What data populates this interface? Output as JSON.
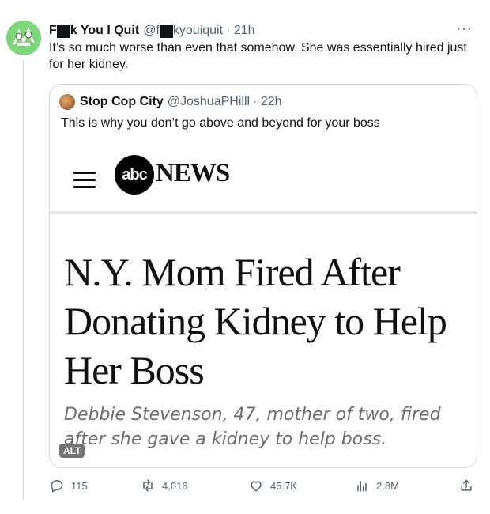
{
  "tweet": {
    "display_name_prefix": "F",
    "display_name_suffix": "k You I Quit",
    "handle_prefix": "@f",
    "handle_suffix": "kyouiquit",
    "time": "· 21h",
    "text": "It’s so much worse than even that somehow. She was essentially hired just for her kidney.",
    "more_label": "···"
  },
  "quote": {
    "display_name": "Stop Cop City",
    "handle": "@JoshuaPHilll",
    "time": "· 22h",
    "text": "This is why you don’t go above and beyond for your boss",
    "media": {
      "logo_text": "abc",
      "brand_text": "NEWS",
      "headline": "N.Y. Mom Fired After Donating Kidney to Help Her Boss",
      "subhead": "Debbie Stevenson, 47, mother of two, fired after she gave a kidney to help boss.",
      "alt_badge": "ALT"
    }
  },
  "actions": {
    "replies": "115",
    "reposts": "4,016",
    "likes": "45.7K",
    "views": "2.8M"
  },
  "colors": {
    "text_primary": "#0f1419",
    "text_secondary": "#536471",
    "border": "#cfd9de",
    "avatar_bg": "#7ed67a"
  }
}
